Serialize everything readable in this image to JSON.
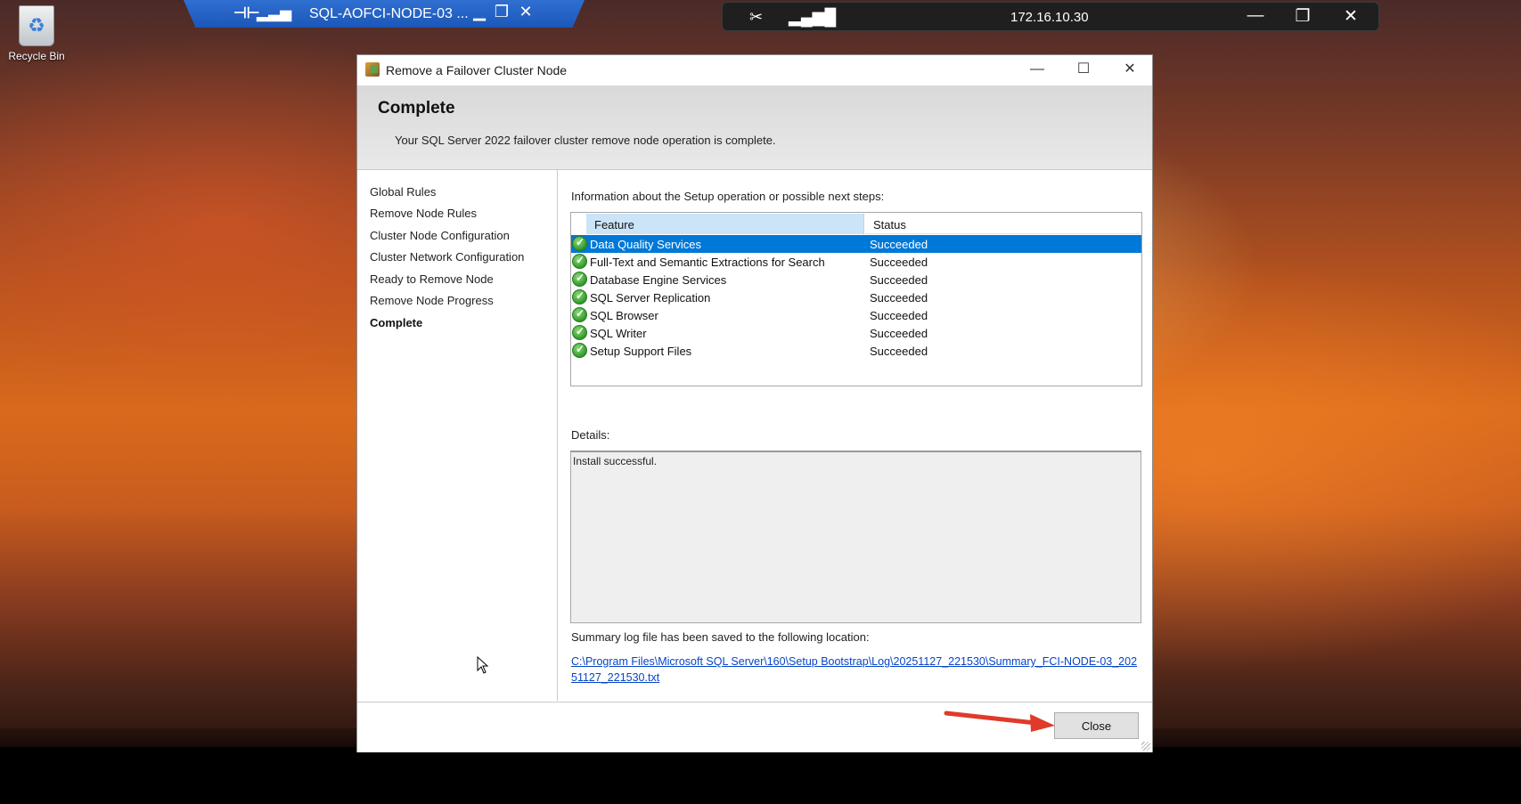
{
  "desktop": {
    "recycle_bin_label": "Recycle Bin"
  },
  "rdp_bar": {
    "title": "SQL-AOFCI-NODE-03 ...",
    "pin_icon": "pin-icon",
    "signal_icon": "signal-icon"
  },
  "rdp_bar2": {
    "ip": "172.16.10.30"
  },
  "dialog": {
    "title": "Remove a Failover Cluster Node",
    "heading": "Complete",
    "subheading": "Your SQL Server 2022 failover cluster remove node operation is complete."
  },
  "nav": {
    "items": [
      {
        "label": "Global Rules",
        "active": false
      },
      {
        "label": "Remove Node Rules",
        "active": false
      },
      {
        "label": "Cluster Node Configuration",
        "active": false
      },
      {
        "label": "Cluster Network Configuration",
        "active": false
      },
      {
        "label": "Ready to Remove Node",
        "active": false
      },
      {
        "label": "Remove Node Progress",
        "active": false
      },
      {
        "label": "Complete",
        "active": true
      }
    ]
  },
  "main": {
    "info_label": "Information about the Setup operation or possible next steps:",
    "columns": {
      "feature": "Feature",
      "status": "Status"
    },
    "rows": [
      {
        "feature": "Data Quality Services",
        "status": "Succeeded",
        "selected": true
      },
      {
        "feature": "Full-Text and Semantic Extractions for Search",
        "status": "Succeeded",
        "selected": false
      },
      {
        "feature": "Database Engine Services",
        "status": "Succeeded",
        "selected": false
      },
      {
        "feature": "SQL Server Replication",
        "status": "Succeeded",
        "selected": false
      },
      {
        "feature": "SQL Browser",
        "status": "Succeeded",
        "selected": false
      },
      {
        "feature": "SQL Writer",
        "status": "Succeeded",
        "selected": false
      },
      {
        "feature": "Setup Support Files",
        "status": "Succeeded",
        "selected": false
      }
    ],
    "details_label": "Details:",
    "details_text": "Install successful.",
    "summary_label": "Summary log file has been saved to the following location:",
    "log_link": "C:\\Program Files\\Microsoft SQL Server\\160\\Setup Bootstrap\\Log\\20251127_221530\\Summary_FCI-NODE-03_20251127_221530.txt"
  },
  "footer": {
    "close_label": "Close"
  },
  "colors": {
    "selection": "#0078d7",
    "header_band": "#e0e0e0",
    "link": "#0645c8",
    "arrow": "#e03a2a",
    "rdp_blue": "#2563c4"
  }
}
